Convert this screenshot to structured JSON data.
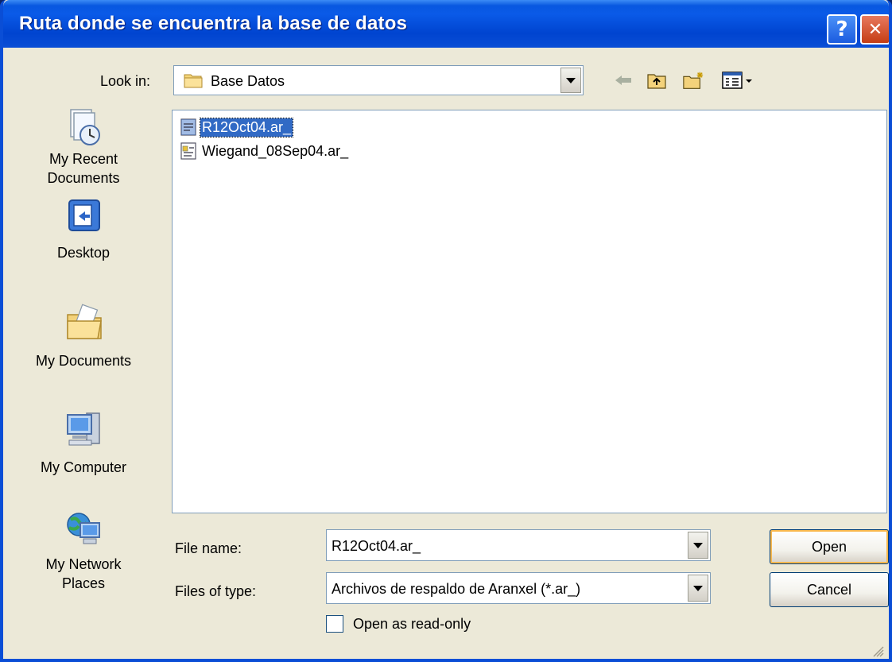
{
  "window": {
    "title": "Ruta donde se encuentra la base de datos",
    "help_label": "?",
    "close_label": "✕"
  },
  "lookin": {
    "label": "Look in:",
    "value": "Base Datos"
  },
  "toolbar": {
    "icons": [
      "back-arrow-icon",
      "up-folder-icon",
      "new-folder-icon",
      "view-menu-icon"
    ]
  },
  "places": [
    {
      "label_line1": "My Recent",
      "label_line2": "Documents",
      "icon": "recent-documents-icon"
    },
    {
      "label_line1": "Desktop",
      "label_line2": "",
      "icon": "desktop-icon"
    },
    {
      "label_line1": "My Documents",
      "label_line2": "",
      "icon": "my-documents-icon"
    },
    {
      "label_line1": "My Computer",
      "label_line2": "",
      "icon": "my-computer-icon"
    },
    {
      "label_line1": "My Network",
      "label_line2": "Places",
      "icon": "network-places-icon"
    }
  ],
  "files": [
    {
      "name": "R12Oct04.ar_",
      "selected": true
    },
    {
      "name": "Wiegand_08Sep04.ar_",
      "selected": false
    }
  ],
  "filename": {
    "label": "File name:",
    "value": "R12Oct04.ar_"
  },
  "filetype": {
    "label": "Files of type:",
    "value": "Archivos de respaldo de Aranxel (*.ar_)"
  },
  "buttons": {
    "open": "Open",
    "cancel": "Cancel"
  },
  "readonly": {
    "label": "Open as read-only",
    "checked": false
  },
  "colors": {
    "titlebar": "#0A4ED6",
    "dialog_bg": "#ECE9D8",
    "selection": "#316AC5"
  }
}
